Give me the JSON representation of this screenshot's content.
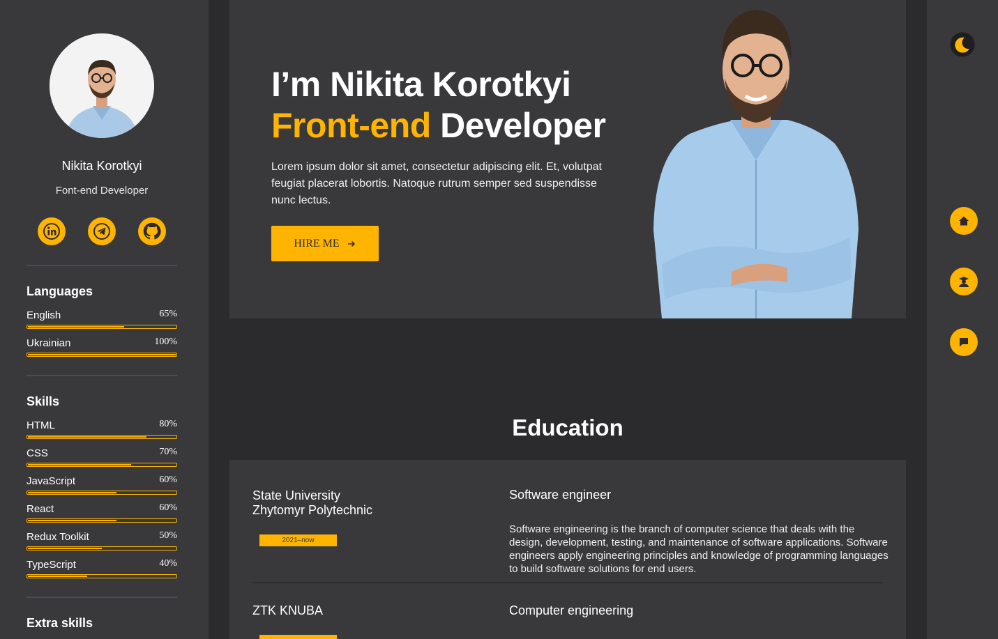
{
  "profile": {
    "name": "Nikita Korotkyi",
    "role": "Font-end Developer"
  },
  "social": [
    {
      "icon": "linkedin-icon"
    },
    {
      "icon": "telegram-icon"
    },
    {
      "icon": "github-icon"
    }
  ],
  "languages": {
    "title": "Languages",
    "items": [
      {
        "label": "English",
        "value": "65%",
        "level": 0.65
      },
      {
        "label": "Ukrainian",
        "value": "100%",
        "level": 1.0
      }
    ]
  },
  "skills": {
    "title": "Skills",
    "items": [
      {
        "label": "HTML",
        "value": "80%",
        "level": 0.8
      },
      {
        "label": "CSS",
        "value": "70%",
        "level": 0.7
      },
      {
        "label": "JavaScript",
        "value": "60%",
        "level": 0.6
      },
      {
        "label": "React",
        "value": "60%",
        "level": 0.6
      },
      {
        "label": "Redux Toolkit",
        "value": "50%",
        "level": 0.5
      },
      {
        "label": "TypeScript",
        "value": "40%",
        "level": 0.4
      }
    ]
  },
  "extra_skills": {
    "title": "Extra skills"
  },
  "hero": {
    "line1": "I’m Nikita Korotkyi",
    "line2_accent": "Front-end",
    "line2_rest": " Developer",
    "text": "Lorem ipsum dolor sit amet, consectetur adipiscing elit. Et, volutpat feugiat placerat lobortis. Natoque rutrum semper sed suspendisse nunc lectus.",
    "button": "HIRE ME"
  },
  "education": {
    "title": "Education",
    "items": [
      {
        "school": "State University\nZhytomyr Polytechnic",
        "date": "2021–now",
        "degree": "Software engineer",
        "description": "Software engineering is the branch of computer science that deals with the design, development, testing, and maintenance of software applications. Software engineers apply engineering principles and knowledge of programming languages to build software solutions for end users."
      },
      {
        "school": "ZTK KNUBA",
        "date": "",
        "degree": "Computer engineering",
        "description": ""
      }
    ]
  },
  "colors": {
    "accent": "#ffb400",
    "panel": "#39393c",
    "background": "#2b2b2e"
  },
  "right_nav": [
    {
      "icon": "moon-icon"
    },
    {
      "icon": "home-icon"
    },
    {
      "icon": "graduate-icon"
    },
    {
      "icon": "chat-icon"
    }
  ]
}
